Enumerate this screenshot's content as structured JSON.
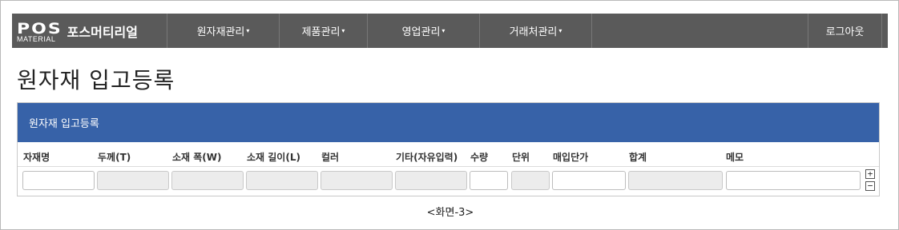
{
  "brand": {
    "logo_top": "POS",
    "logo_bottom": "MATERIAL",
    "name": "포스머티리얼"
  },
  "nav": {
    "items": [
      {
        "label": "원자재관리",
        "caret": "▾"
      },
      {
        "label": "제품관리",
        "caret": "▾"
      },
      {
        "label": "영업관리",
        "caret": "▾"
      },
      {
        "label": "거래처관리",
        "caret": "▾"
      }
    ],
    "logout": "로그아웃"
  },
  "page": {
    "title": "원자재 입고등록"
  },
  "panel": {
    "heading": "원자재 입고등록",
    "columns": [
      "자재명",
      "두께(T)",
      "소재 폭(W)",
      "소재 길이(L)",
      "컬러",
      "기타(자유입력)",
      "수량",
      "단위",
      "매입단가",
      "합계",
      "메모"
    ],
    "row_controls": {
      "add": "+",
      "remove": "−"
    }
  },
  "caption": "<화면-3>",
  "colors": {
    "navbar": "#5a5a5a",
    "panel_heading": "#3762a8",
    "readonly_field": "#ececec"
  }
}
